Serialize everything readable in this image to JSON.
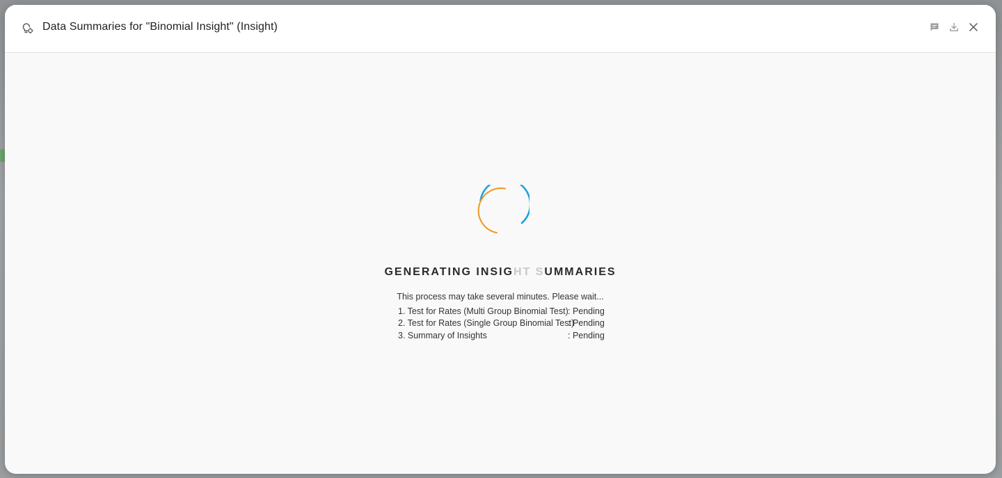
{
  "dialog": {
    "title": "Data Summaries for \"Binomial Insight\" (Insight)",
    "header_icon": "insight-lightbulb-icon",
    "actions": [
      {
        "name": "feedback-button",
        "icon": "comment-icon"
      },
      {
        "name": "download-button",
        "icon": "download-icon"
      },
      {
        "name": "close-button",
        "icon": "close-icon"
      }
    ]
  },
  "loading": {
    "title_main": "GENERATING INSIG",
    "title_faded": "HT S",
    "title_end": "UMMARIES",
    "wait_message": "This process may take several minutes. Please wait...",
    "tasks": [
      {
        "name": "1. Test for Rates (Multi Group Binomial Test)",
        "status": ": Pending"
      },
      {
        "name": "2. Test for Rates (Single Group Binomial Test)",
        "status": ": Pending"
      },
      {
        "name": "3. Summary of Insights",
        "status": ": Pending"
      }
    ]
  },
  "colors": {
    "spinner_outer": "#1aa3e0",
    "spinner_inner": "#f0961e",
    "dialog_bg": "#f9f9f9",
    "header_bg": "#ffffff",
    "icon_gray": "#9e9e9e"
  }
}
